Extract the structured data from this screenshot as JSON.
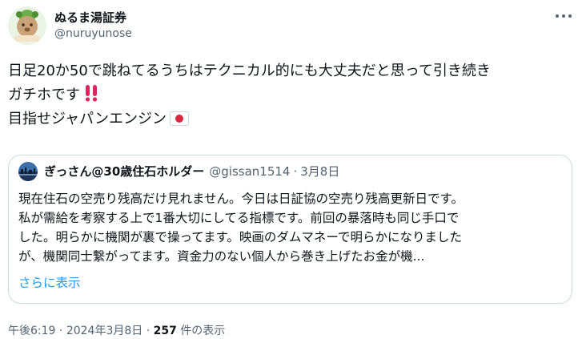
{
  "author": {
    "display_name": "ぬるま湯証券",
    "handle": "@nuruyunose",
    "avatar_icon": "bear-character-avatar"
  },
  "tweet": {
    "lines": [
      "日足20か50で跳ねてるうちはテクニカル的にも大丈夫だと思って引き続き",
      "ガチホです",
      "目指せジャパンエンジン"
    ],
    "emojis": [
      "double-exclamation-icon",
      "japan-flag-icon"
    ]
  },
  "quoted": {
    "display_name": "ぎっさん@30歳住石ホルダー",
    "handle": "@gissan1514",
    "separator": "·",
    "date": "3月8日",
    "avatar_icon": "city-skyline-avatar",
    "lines": [
      "現在住石の空売り残高だけ見れません。今日は日証協の空売り残高更新日です。",
      "私が需給を考察する上で1番大切にしてる指標です。前回の暴落時も同じ手口で",
      "した。明らかに機関が裏で操ってます。映画のダムマネーで明らかになりました",
      "が、機関同士繋がってます。資金力のない個人から巻き上げたお金が機..."
    ],
    "show_more": "さらに表示"
  },
  "footer": {
    "time": "午後6:19",
    "separator": "·",
    "date": "2024年3月8日",
    "views_count": "257",
    "views_label": "件の表示"
  },
  "colors": {
    "text": "#0f1419",
    "secondary": "#536471",
    "link": "#1d9bf0",
    "border": "#cfd9de",
    "exclamation": "#e0245e"
  }
}
